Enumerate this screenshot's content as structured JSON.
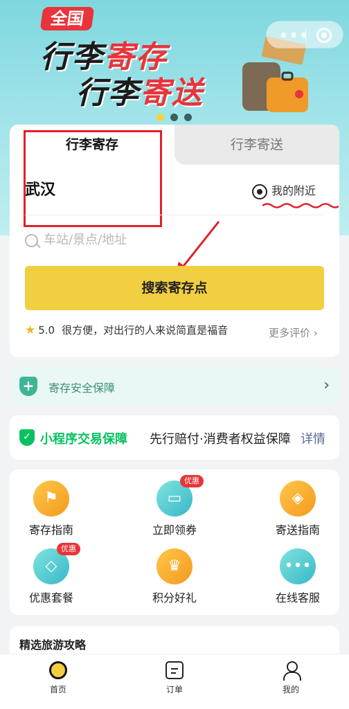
{
  "banner": {
    "badge": "全国",
    "line1_black": "行李",
    "line1_red": "寄存",
    "line2_black": "行李",
    "line2_red": "寄送",
    "carousel_dots": 3,
    "active_dot": 0
  },
  "capsule": {
    "more_label": "•••"
  },
  "search": {
    "tabs": [
      {
        "label": "行李寄存",
        "active": true
      },
      {
        "label": "行李寄送",
        "active": false
      }
    ],
    "city": "武汉",
    "nearby": "我的附近",
    "placeholder": "车站/景点/地址",
    "button": "搜索寄存点",
    "review": {
      "score": "5.0",
      "text": "很方便，对出行的人来说简直是福音",
      "more": "更多评价"
    }
  },
  "security": {
    "label": "寄存安全保障"
  },
  "guarantee": {
    "label": "小程序交易保障",
    "text": "先行赔付·消费者权益保障",
    "link": "详情"
  },
  "grid": {
    "items": [
      {
        "label": "寄存指南",
        "badge": ""
      },
      {
        "label": "立即领券",
        "badge": "优惠"
      },
      {
        "label": "寄送指南",
        "badge": ""
      },
      {
        "label": "优惠套餐",
        "badge": "优惠"
      },
      {
        "label": "积分好礼",
        "badge": ""
      },
      {
        "label": "在线客服",
        "badge": ""
      }
    ]
  },
  "strategy": {
    "title": "精选旅游攻略"
  },
  "tabbar": {
    "home": "首页",
    "orders": "订单",
    "me": "我的"
  },
  "colors": {
    "accent_yellow": "#f2cf41",
    "banner_red": "#e8343a",
    "wechat_green": "#07c160",
    "annotation_red": "#e0202a"
  }
}
